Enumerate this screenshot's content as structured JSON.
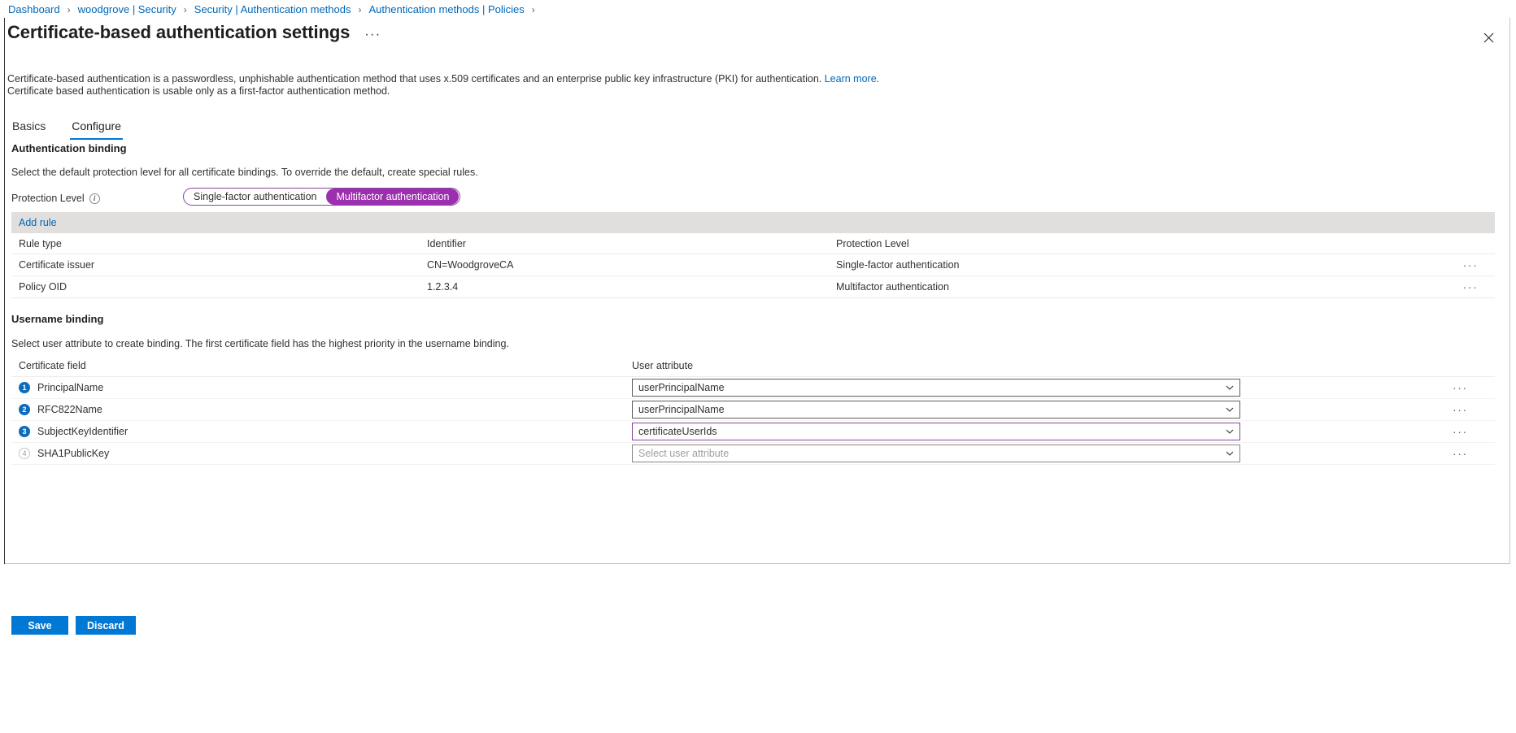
{
  "breadcrumb": {
    "items": [
      {
        "label": "Dashboard"
      },
      {
        "label": "woodgrove | Security"
      },
      {
        "label": "Security | Authentication methods"
      },
      {
        "label": "Authentication methods | Policies"
      }
    ],
    "separator": "›"
  },
  "header": {
    "title": "Certificate-based authentication settings",
    "more_label": "···",
    "close_label": "✕"
  },
  "description": {
    "line1_before_link": "Certificate-based authentication is a passwordless, unphishable authentication method that uses x.509 certificates and an enterprise public key infrastructure (PKI) for authentication. ",
    "link_label": "Learn more",
    "line1_after_link": ".",
    "line2": "Certificate based authentication is usable only as a first-factor authentication method."
  },
  "tabs": [
    {
      "label": "Basics",
      "active": false
    },
    {
      "label": "Configure",
      "active": true
    }
  ],
  "auth_binding": {
    "heading": "Authentication binding",
    "subtext": "Select the default protection level for all certificate bindings. To override the default, create special rules.",
    "protection_level_label": "Protection Level",
    "info_glyph": "i",
    "options": [
      {
        "label": "Single-factor authentication",
        "selected": false
      },
      {
        "label": "Multifactor authentication",
        "selected": true
      }
    ],
    "selected_value": "Multifactor authentication",
    "accent_purple": "#9b2fae"
  },
  "rules_grid": {
    "add_rule_label": "Add rule",
    "columns": [
      "Rule type",
      "Identifier",
      "Protection Level"
    ],
    "rows": [
      {
        "rule_type": "Certificate issuer",
        "identifier": "CN=WoodgroveCA",
        "protection_level": "Single-factor authentication",
        "actions_label": "···"
      },
      {
        "rule_type": "Policy OID",
        "identifier": "1.2.3.4",
        "protection_level": "Multifactor authentication",
        "actions_label": "···"
      }
    ]
  },
  "username_binding": {
    "heading": "Username binding",
    "subtext": "Select user attribute to create binding. The first certificate field has the highest priority in the username binding.",
    "columns": [
      "Certificate field",
      "User attribute"
    ],
    "rows": [
      {
        "order": "1",
        "certificate_field": "PrincipalName",
        "user_attribute": "userPrincipalName",
        "placeholder": "Select user attribute",
        "state": "normal",
        "actions_label": "···"
      },
      {
        "order": "2",
        "certificate_field": "RFC822Name",
        "user_attribute": "userPrincipalName",
        "placeholder": "Select user attribute",
        "state": "normal",
        "actions_label": "···"
      },
      {
        "order": "3",
        "certificate_field": "SubjectKeyIdentifier",
        "user_attribute": "certificateUserIds",
        "placeholder": "Select user attribute",
        "state": "highlighted",
        "actions_label": "···"
      },
      {
        "order": "4",
        "certificate_field": "SHA1PublicKey",
        "user_attribute": "",
        "placeholder": "Select user attribute",
        "state": "empty",
        "actions_label": "···"
      }
    ]
  },
  "footer": {
    "save_label": "Save",
    "discard_label": "Discard",
    "primary_color": "#0078d4"
  }
}
